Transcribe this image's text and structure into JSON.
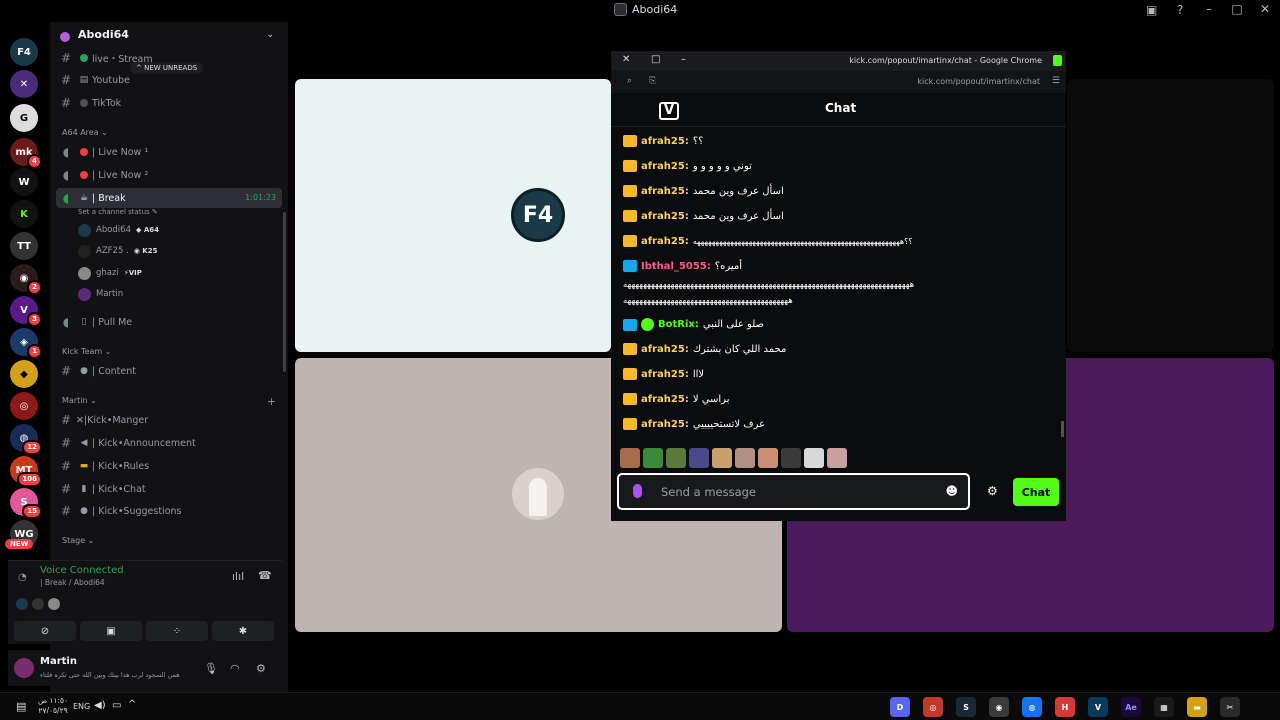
{
  "window": {
    "title": "Abodi64"
  },
  "rail": {
    "servers": [
      {
        "name": "server-f4",
        "badge": ""
      },
      {
        "name": "server-purple",
        "badge": ""
      },
      {
        "name": "server-g",
        "badge": ""
      },
      {
        "name": "server-red",
        "badge": "4"
      },
      {
        "name": "server-w",
        "badge": ""
      },
      {
        "name": "server-kick",
        "badge": ""
      },
      {
        "name": "server-tt",
        "badge": ""
      },
      {
        "name": "server-valorant",
        "badge": "2"
      },
      {
        "name": "server-v",
        "badge": "3"
      },
      {
        "name": "server-cyber",
        "badge": "1"
      },
      {
        "name": "server-gold",
        "badge": ""
      },
      {
        "name": "server-red2",
        "badge": ""
      },
      {
        "name": "server-blue",
        "badge": "12"
      },
      {
        "name": "server-mt",
        "badge": "106"
      },
      {
        "name": "server-pink",
        "badge": "15"
      },
      {
        "name": "server-wg",
        "badge": ""
      }
    ],
    "new_label": "NEW"
  },
  "sidebar": {
    "guild_name": "Abodi64",
    "new_unreads": "^ NEW UNREADS",
    "channels_top": [
      {
        "label": "live・Stream"
      },
      {
        "label": "Youtube"
      },
      {
        "label": "TikTok"
      }
    ],
    "category_a64": "A64 Area",
    "voice_channels": [
      {
        "label": "| Live Now ¹"
      },
      {
        "label": "| Live Now ²"
      }
    ],
    "break_channel": "| Break",
    "break_timer": "1:01:23",
    "channel_status": "Set a channel status",
    "voice_users": [
      {
        "name": "Abodi64",
        "tag": "A64"
      },
      {
        "name": "AZF25 .",
        "tag": "K25"
      },
      {
        "name": "ghazi",
        "tag": "VIP"
      },
      {
        "name": "Martin",
        "tag": ""
      }
    ],
    "pull_me": "| Pull Me",
    "category_kick": "Kick Team",
    "content": "| Content",
    "category_martin": "Martin",
    "martin_channels": [
      {
        "label": "✕|Kick•Manger"
      },
      {
        "label": "| Kick•Announcement"
      },
      {
        "label": "| Kick•Rules"
      },
      {
        "label": "| Kick•Chat"
      },
      {
        "label": "| Kick•Suggestions"
      }
    ],
    "category_stage": "Stage"
  },
  "voice_panel": {
    "status": "Voice Connected",
    "location": "| Break / Abodi64"
  },
  "user_panel": {
    "name": "Martin",
    "status": "همن السجود لرب هذا بيتك وبين الله حتى تكره فلتاء"
  },
  "popout": {
    "window_title": "kick.com/popout/imartinx/chat - Google Chrome",
    "url": "kick.com/popout/imartinx/chat",
    "header": "Chat",
    "messages": [
      {
        "user": "afrah25:",
        "text": "؟؟",
        "badge": "crown"
      },
      {
        "user": "afrah25:",
        "text": "توني و و و و و",
        "badge": "crown"
      },
      {
        "user": "afrah25:",
        "text": "اسأل عرف وين محمد",
        "badge": "crown"
      },
      {
        "user": "afrah25:",
        "text": "اسأل عرف وين محمد",
        "badge": "crown"
      },
      {
        "user": "afrah25:",
        "text": "؟؟ههههههههههههههههههههههههههههههههههههههههههههههههههههههههه",
        "badge": "crown"
      },
      {
        "user": "Ibthal_5055:",
        "text": "أميره؟",
        "badge": "blue"
      }
    ],
    "wrap_line1": "هههههههههههههههههههههههههههههههههههههههههههههههههههههههههههههههههههههههههه",
    "wrap_line2": "ههههههههههههههههههههههههههههههههههههههههههه",
    "messages2": [
      {
        "user": "BotRix:",
        "text": "صلو على النبي",
        "badge": "bot"
      },
      {
        "user": "afrah25:",
        "text": "محمد اللي كان بشترك",
        "badge": "crown"
      },
      {
        "user": "afrah25:",
        "text": "لااا",
        "badge": "crown"
      },
      {
        "user": "afrah25:",
        "text": "براسي لا",
        "badge": "crown"
      },
      {
        "user": "afrah25:",
        "text": "عرف لاتستحييييي",
        "badge": "crown"
      }
    ],
    "input_placeholder": "Send a message",
    "chat_button": "Chat"
  },
  "taskbar": {
    "time": "١١:٥٠ ص",
    "date": "٢٧/٠٥/٢٩",
    "lang": "ENG"
  }
}
